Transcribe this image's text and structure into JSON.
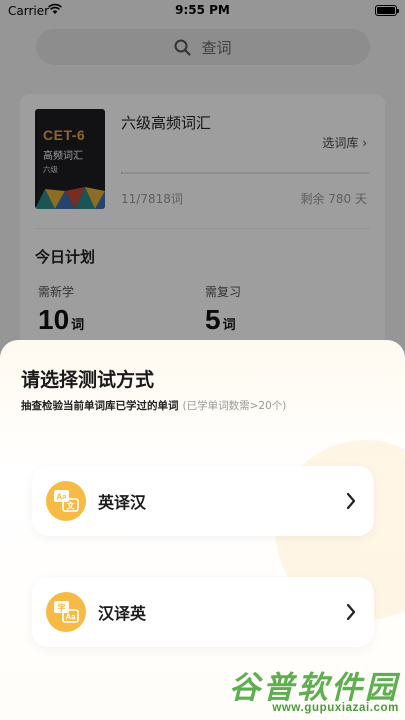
{
  "status_bar": {
    "carrier": "Carrier",
    "time": "9:55 PM"
  },
  "search": {
    "placeholder": "查词"
  },
  "book": {
    "cover_code": "CET-6",
    "cover_title": "高频词汇",
    "cover_level": "六级",
    "name": "六级高频词汇",
    "switch_label": "选词库 ›",
    "progress_text": "11/7818词",
    "progress_fraction": 0.0014,
    "days_left": "剩余 780 天"
  },
  "today": {
    "title": "今日计划",
    "new_label": "需新学",
    "new_value": "10",
    "review_label": "需复习",
    "review_value": "5",
    "unit": "词"
  },
  "sheet": {
    "title": "请选择测试方式",
    "subtitle": "抽查检验当前单词库已学过的单词",
    "note": "(已学单词数需>20个)",
    "options": [
      {
        "label": "英译汉",
        "icon": "en-to-zh-translate-icon"
      },
      {
        "label": "汉译英",
        "icon": "zh-to-en-translate-icon"
      }
    ]
  },
  "watermark": {
    "main": "谷普软件园",
    "url": "www.gupuxiazai.com"
  },
  "colors": {
    "accent": "#f7bb45",
    "cover_text": "#e8a341",
    "watermark": "#5fae4f"
  }
}
